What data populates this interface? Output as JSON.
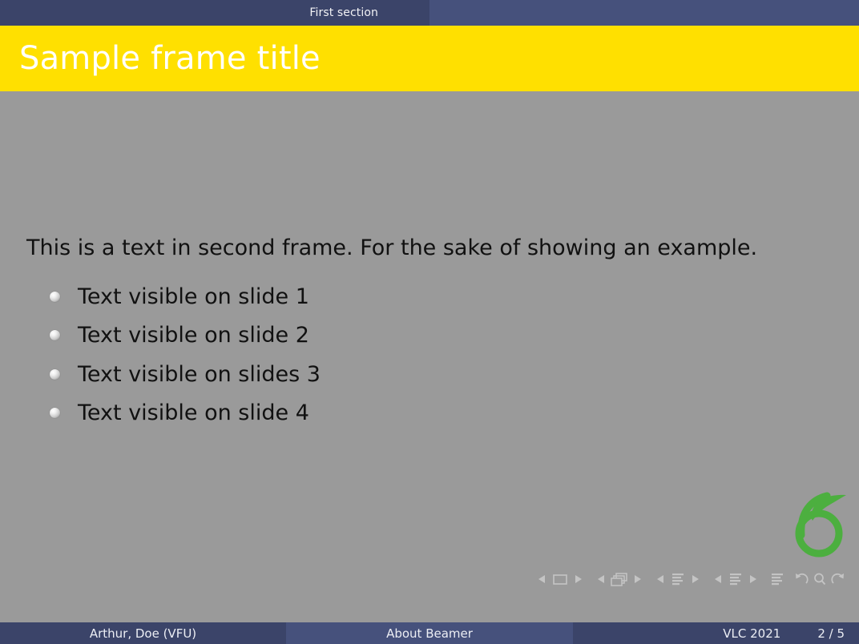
{
  "header": {
    "sections": [
      {
        "label": "First section",
        "current": true
      },
      {
        "label": "",
        "current": false
      }
    ]
  },
  "title": {
    "text": "Sample frame title",
    "background_color": "#ffe000",
    "text_color": "#ffffff"
  },
  "body": {
    "background_color": "#9a9a9a",
    "intro": "This is a text in second frame.  For the sake of showing an example.",
    "bullets": [
      {
        "label": "Text visible on slide 1",
        "marker": "ball-bullet-icon"
      },
      {
        "label": "Text visible on slide 2",
        "marker": "ball-bullet-icon"
      },
      {
        "label": "Text visible on slides 3",
        "marker": "ball-bullet-icon"
      },
      {
        "label": "Text visible on slide 4",
        "marker": "ball-bullet-icon"
      }
    ]
  },
  "logo": {
    "name": "green-sprout-six-logo",
    "color": "#4caf3f"
  },
  "navigation_symbols": {
    "items": [
      "slide-previous-icon",
      "slide-icon",
      "slide-next-icon",
      "frame-previous-icon",
      "frame-icon",
      "frame-next-icon",
      "subsection-previous-icon",
      "subsection-icon",
      "subsection-next-icon",
      "section-previous-icon",
      "section-icon",
      "section-next-icon",
      "presentation-icon",
      "back-icon",
      "search-icon",
      "forward-icon"
    ]
  },
  "footer": {
    "author": "Arthur, Doe  (VFU)",
    "short_title": "About Beamer",
    "date": "VLC 2021",
    "page": "2 / 5",
    "accent_color": "#3b4469",
    "accent_color_light": "#46517c"
  }
}
